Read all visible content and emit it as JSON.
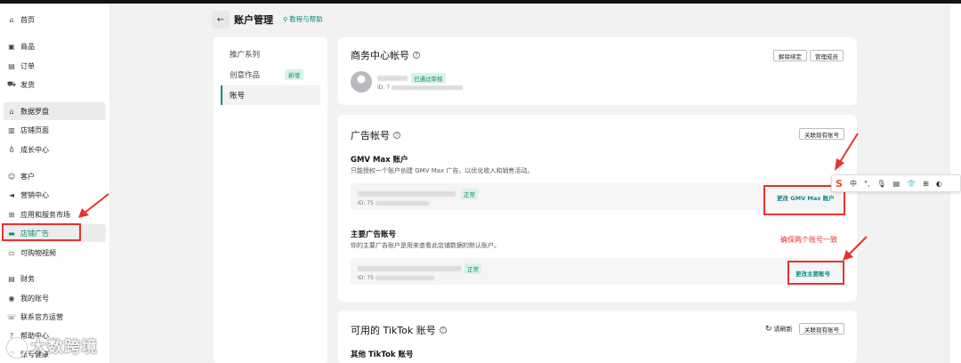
{
  "sidebar": {
    "items": [
      {
        "label": "首页",
        "icon": "home-icon",
        "glyph": "⌂"
      },
      {
        "label": "商品",
        "icon": "box-icon",
        "glyph": "▣"
      },
      {
        "label": "订单",
        "icon": "clipboard-icon",
        "glyph": "▤"
      },
      {
        "label": "发货",
        "icon": "truck-icon",
        "glyph": "⛟"
      },
      {
        "label": "数据罗盘",
        "icon": "compass-icon",
        "glyph": "⌂"
      },
      {
        "label": "店铺页面",
        "icon": "store-page-icon",
        "glyph": "▥"
      },
      {
        "label": "成长中心",
        "icon": "growth-icon",
        "glyph": "♁"
      },
      {
        "label": "客户",
        "icon": "users-icon",
        "glyph": "☺"
      },
      {
        "label": "营销中心",
        "icon": "megaphone-icon",
        "glyph": "◄"
      },
      {
        "label": "应用和服务市场",
        "icon": "apps-icon",
        "glyph": "⊞"
      },
      {
        "label": "店铺广告",
        "icon": "ad-icon",
        "glyph": "▬"
      },
      {
        "label": "可购物视频",
        "icon": "video-icon",
        "glyph": "▭"
      },
      {
        "label": "财务",
        "icon": "wallet-icon",
        "glyph": "▤"
      },
      {
        "label": "我的账号",
        "icon": "account-icon",
        "glyph": "◉"
      },
      {
        "label": "联系官方运营",
        "icon": "contact-icon",
        "glyph": "☏"
      },
      {
        "label": "帮助中心",
        "icon": "help-icon",
        "glyph": "?"
      },
      {
        "label": "账号健康",
        "icon": "health-icon",
        "glyph": "♡"
      }
    ],
    "watermark": "大数跨境"
  },
  "header": {
    "back_glyph": "←",
    "title": "账户管理",
    "help_link": "教程与帮助",
    "help_glyph": "⚲"
  },
  "submenu": {
    "items": [
      {
        "label": "推广系列"
      },
      {
        "label": "创意作品",
        "badge": "新增"
      },
      {
        "label": "账号"
      }
    ]
  },
  "business_center": {
    "title": "商务中心帐号",
    "unbind_button": "解除绑定",
    "manage_button": "管理成员",
    "status": "已通过审核",
    "id_prefix": "ID: 7"
  },
  "ad_accounts": {
    "title": "广告帐号",
    "link_button": "关联现有账号",
    "gmv_max": {
      "title": "GMV Max 账户",
      "desc": "只能授权一个账户创建 GMV Max 广告，以优化收入和销售活动。",
      "status": "正常",
      "id_prefix": "ID: 75",
      "change_link": "更改 GMV Max 账户"
    },
    "primary": {
      "title": "主要广告账号",
      "desc": "你的主要广告账户是用来查看此店铺数据的默认账户。",
      "status": "正常",
      "id_prefix": "ID: 75",
      "change_link": "更改主要账号"
    },
    "annotation": "确保两个账号一致"
  },
  "tiktok_accounts": {
    "title": "可用的 TikTok 账号",
    "refresh": "请刷新",
    "refresh_glyph": "↻",
    "link_button": "关联现有账号",
    "other_title": "其他 TikTok 账号"
  },
  "ime_toolbar": {
    "logo": "S",
    "items": [
      "中",
      "°,",
      "🎙",
      "▤",
      "👕",
      "⊞",
      "◐"
    ]
  },
  "colors": {
    "accent": "#0d8a82",
    "annotation_red": "#e8322d",
    "success_bg": "#d8f3e7",
    "success_text": "#15885c"
  }
}
